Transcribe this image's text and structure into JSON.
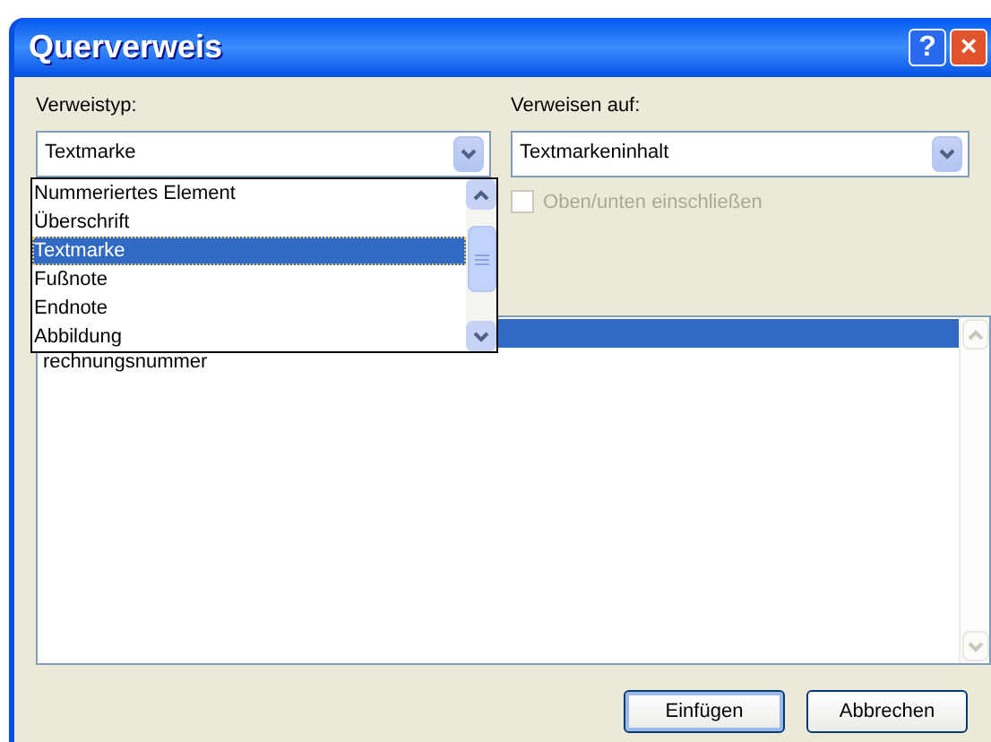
{
  "window": {
    "title": "Querverweis"
  },
  "title_buttons": [
    {
      "kind": "help",
      "label": "?"
    },
    {
      "kind": "close",
      "label": "×"
    }
  ],
  "reference_type": {
    "label": "Verweistyp:",
    "value": "Textmarke",
    "open": true,
    "options": [
      {
        "label": "Nummeriertes Element",
        "selected": false
      },
      {
        "label": "Überschrift",
        "selected": false
      },
      {
        "label": "Textmarke",
        "selected": true
      },
      {
        "label": "Fußnote",
        "selected": false
      },
      {
        "label": "Endnote",
        "selected": false
      },
      {
        "label": "Abbildung",
        "selected": false
      }
    ]
  },
  "insert_reference_to": {
    "label": "Verweisen auf:",
    "value": "Textmarkeninhalt"
  },
  "include_above_below": {
    "label": "Oben/unten einschließen",
    "checked": false,
    "disabled": true
  },
  "bookmarks": [
    {
      "selected": true
    },
    {
      "label": "rechnungsnummer",
      "selected": false
    }
  ],
  "buttons": [
    {
      "label": "Einfügen",
      "default": true
    },
    {
      "label": "Abbrechen",
      "default": false
    }
  ]
}
